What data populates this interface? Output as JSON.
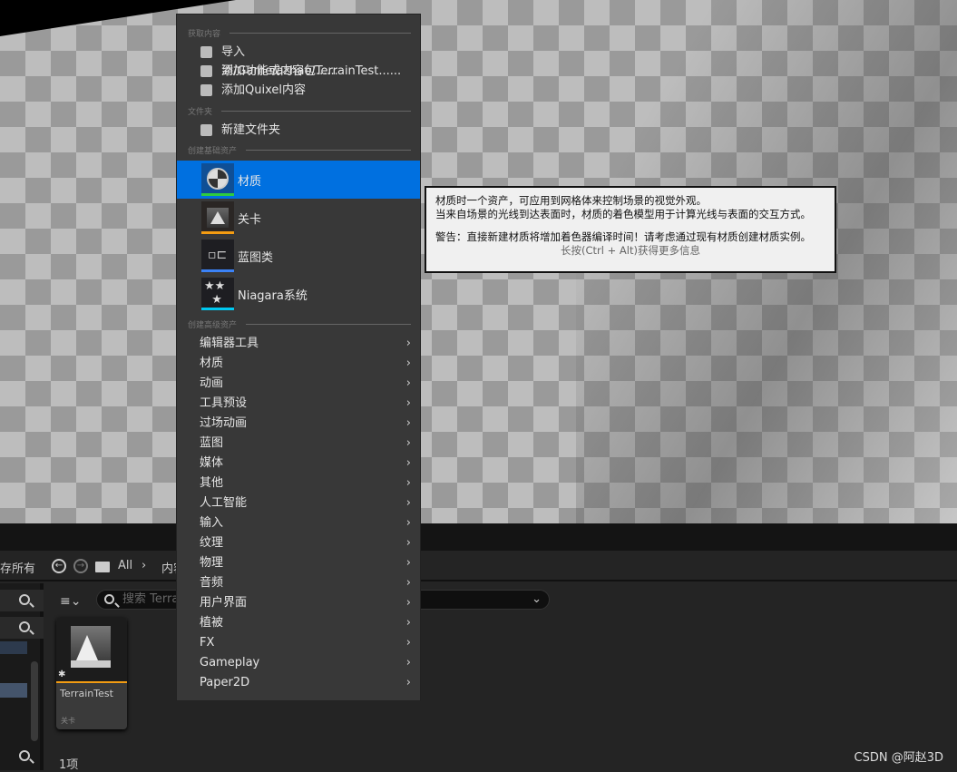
{
  "menu": {
    "sections": {
      "get": "获取内容",
      "folder": "文件夹",
      "basic": "创建基础资产",
      "advanced": "创建高级资产"
    },
    "get_items": [
      {
        "label": "导入到/Game/azhao/TerrainTest......",
        "icon": "import-icon"
      },
      {
        "label": "添加功能或内容包......",
        "icon": "add-feature-pack-icon"
      },
      {
        "label": "添加Quixel内容",
        "icon": "quixel-icon"
      }
    ],
    "folder_items": [
      {
        "label": "新建文件夹",
        "icon": "new-folder-icon"
      }
    ],
    "basic_items": [
      {
        "label": "材质",
        "icon": "material-icon",
        "color": "#2ecc40",
        "selected": true
      },
      {
        "label": "关卡",
        "icon": "level-icon",
        "color": "#f39c12"
      },
      {
        "label": "蓝图类",
        "icon": "blueprint-icon",
        "color": "#3b82f6"
      },
      {
        "label": "Niagara系统",
        "icon": "niagara-icon",
        "color": "#00c8f0"
      }
    ],
    "advanced_items": [
      "编辑器工具",
      "材质",
      "动画",
      "工具预设",
      "过场动画",
      "蓝图",
      "媒体",
      "其他",
      "人工智能",
      "输入",
      "纹理",
      "物理",
      "音频",
      "用户界面",
      "植被",
      "FX",
      "Gameplay",
      "Paper2D"
    ]
  },
  "tooltip": {
    "line1": "材质时一个资产，可应用到网格体来控制场景的视觉外观。",
    "line2": "当来自场景的光线到达表面时，材质的着色模型用于计算光线与表面的交互方式。",
    "warning": "警告：直接新建材质将增加着色器编译时间！请考虑通过现有材质创建材质实例。",
    "hint": "长按(Ctrl + Alt)获得更多信息"
  },
  "toolbar": {
    "save_all": "存所有",
    "path_all": "All",
    "path_next": "内容"
  },
  "search": {
    "placeholder": "搜索 Terra"
  },
  "asset": {
    "name": "TerrainTest",
    "type": "关卡"
  },
  "status": {
    "count": "1项"
  },
  "watermark": "CSDN @阿赵3D",
  "colors": {
    "selection": "#0070e0",
    "level": "#f39c12"
  }
}
